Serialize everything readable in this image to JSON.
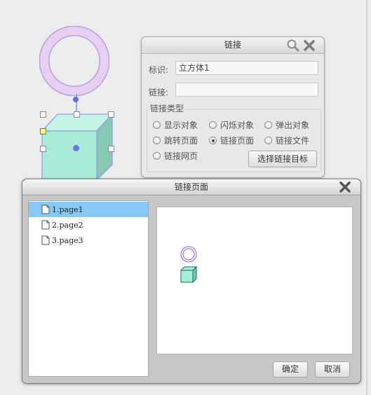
{
  "link_panel": {
    "title": "链接",
    "id_label": "标识:",
    "id_value": "立方体1",
    "link_label": "链接:",
    "link_value": "",
    "type_legend": "链接类型",
    "options": [
      {
        "label": "显示对象",
        "selected": false
      },
      {
        "label": "闪烁对象",
        "selected": false
      },
      {
        "label": "弹出对象",
        "selected": false
      },
      {
        "label": "跳转页面",
        "selected": false
      },
      {
        "label": "链接页面",
        "selected": true
      },
      {
        "label": "链接文件",
        "selected": false
      },
      {
        "label": "链接网页",
        "selected": false
      }
    ],
    "choose_target_label": "选择链接目标"
  },
  "link_page_dialog": {
    "title": "链接页面",
    "pages": [
      "1.page1",
      "2.page2",
      "3.page3"
    ],
    "selected_index": 0,
    "ok_label": "确定",
    "cancel_label": "取消"
  },
  "colors": {
    "ring_fill": "#e6cff0",
    "ring_stroke": "#b7a0e0",
    "cube_front": "#a8ecd7",
    "cube_top": "#c4f3e4",
    "cube_side": "#86c9b3",
    "selection_blue": "#87c8f5"
  }
}
